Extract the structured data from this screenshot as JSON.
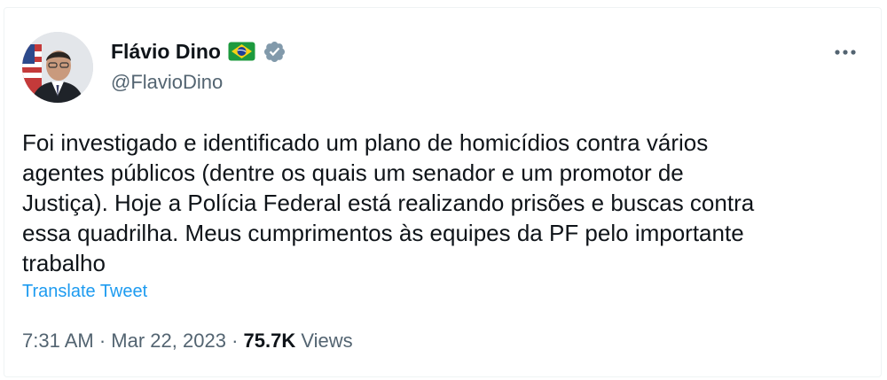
{
  "author": {
    "name": "Flávio Dino",
    "handle": "@FlavioDino",
    "flag_icon": "brazil-flag-icon",
    "verified_icon": "verified-badge-icon"
  },
  "tweet": {
    "lines": [
      "Foi investigado e identificado um plano de homicídios contra vários",
      "agentes públicos (dentre os quais um senador e um promotor de",
      "Justiça). Hoje a Polícia Federal está realizando prisões e buscas contra",
      "essa quadrilha. Meus cumprimentos às equipes da PF pelo importante",
      "trabalho"
    ],
    "translate_label": "Translate Tweet"
  },
  "meta": {
    "time": "7:31 AM",
    "separator": "·",
    "date": "Mar 22, 2023",
    "views_count": "75.7K",
    "views_label": "Views"
  },
  "colors": {
    "text": "#0f1419",
    "secondary": "#536471",
    "link": "#1d9bf0",
    "verified_badge": "#829aab"
  }
}
